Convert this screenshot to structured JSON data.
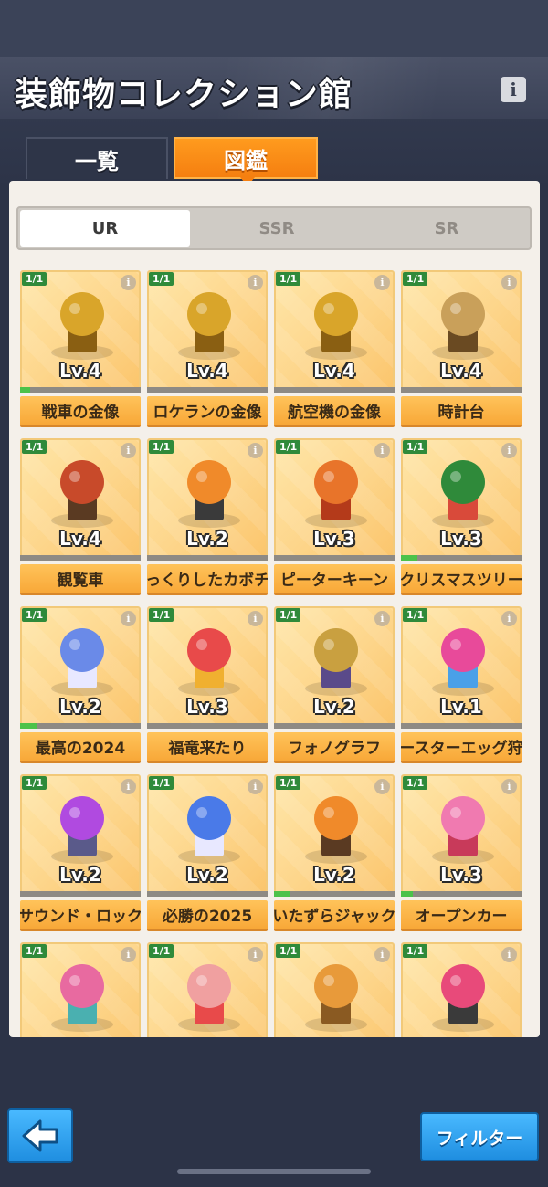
{
  "header": {
    "title": "装飾物コレクション館",
    "info_icon": "i"
  },
  "tabs": [
    {
      "label": "一覧",
      "active": false
    },
    {
      "label": "図鑑",
      "active": true
    }
  ],
  "rarity_tabs": [
    {
      "label": "UR",
      "active": true
    },
    {
      "label": "SSR",
      "active": false
    },
    {
      "label": "SR",
      "active": false
    }
  ],
  "cards": [
    {
      "count": "1/1",
      "level": "Lv.4",
      "name": "戦車の金像",
      "progress": 0.08,
      "icon": "tank-statue-icon"
    },
    {
      "count": "1/1",
      "level": "Lv.4",
      "name": "ロケランの金像",
      "progress": 0.0,
      "icon": "rocket-launcher-statue-icon"
    },
    {
      "count": "1/1",
      "level": "Lv.4",
      "name": "航空機の金像",
      "progress": 0.0,
      "icon": "aircraft-statue-icon"
    },
    {
      "count": "1/1",
      "level": "Lv.4",
      "name": "時計台",
      "progress": 0.0,
      "icon": "clock-tower-icon"
    },
    {
      "count": "1/1",
      "level": "Lv.4",
      "name": "観覧車",
      "progress": 0.0,
      "icon": "ferris-wheel-icon"
    },
    {
      "count": "1/1",
      "level": "Lv.2",
      "name": "びっくりしたカボチャ",
      "progress": 0.0,
      "icon": "pumpkin-icon"
    },
    {
      "count": "1/1",
      "level": "Lv.3",
      "name": "ピーターキーン",
      "progress": 0.0,
      "icon": "turkey-icon"
    },
    {
      "count": "1/1",
      "level": "Lv.3",
      "name": "クリスマスツリー",
      "progress": 0.14,
      "icon": "christmas-tree-icon"
    },
    {
      "count": "1/1",
      "level": "Lv.2",
      "name": "最高の2024",
      "progress": 0.14,
      "icon": "year-2024-icon"
    },
    {
      "count": "1/1",
      "level": "Lv.3",
      "name": "福竜来たり",
      "progress": 0.0,
      "icon": "dragon-icon"
    },
    {
      "count": "1/1",
      "level": "Lv.2",
      "name": "フォノグラフ",
      "progress": 0.0,
      "icon": "phonograph-icon"
    },
    {
      "count": "1/1",
      "level": "Lv.1",
      "name": "イースターエッグ狩り",
      "progress": 0.0,
      "icon": "easter-bunny-icon"
    },
    {
      "count": "1/1",
      "level": "Lv.2",
      "name": "サウンド・ロック",
      "progress": 0.0,
      "icon": "rock-guitar-icon"
    },
    {
      "count": "1/1",
      "level": "Lv.2",
      "name": "必勝の2025",
      "progress": 0.0,
      "icon": "year-2025-icon"
    },
    {
      "count": "1/1",
      "level": "Lv.2",
      "name": "いたずらジャック",
      "progress": 0.14,
      "icon": "jack-o-lantern-icon"
    },
    {
      "count": "1/1",
      "level": "Lv.3",
      "name": "オープンカー",
      "progress": 0.1,
      "icon": "open-car-icon"
    },
    {
      "count": "1/1",
      "level": "",
      "name": "",
      "progress": 0.0,
      "icon": "hearts-tower-icon"
    },
    {
      "count": "1/1",
      "level": "",
      "name": "",
      "progress": 0.0,
      "icon": "rabbit-egg-icon"
    },
    {
      "count": "1/1",
      "level": "",
      "name": "",
      "progress": 0.0,
      "icon": "cornucopia-icon"
    },
    {
      "count": "1/1",
      "level": "",
      "name": "",
      "progress": 0.0,
      "icon": "gift-box-icon"
    }
  ],
  "footer": {
    "back_icon": "arrow-left-icon",
    "filter_label": "フィルター"
  }
}
